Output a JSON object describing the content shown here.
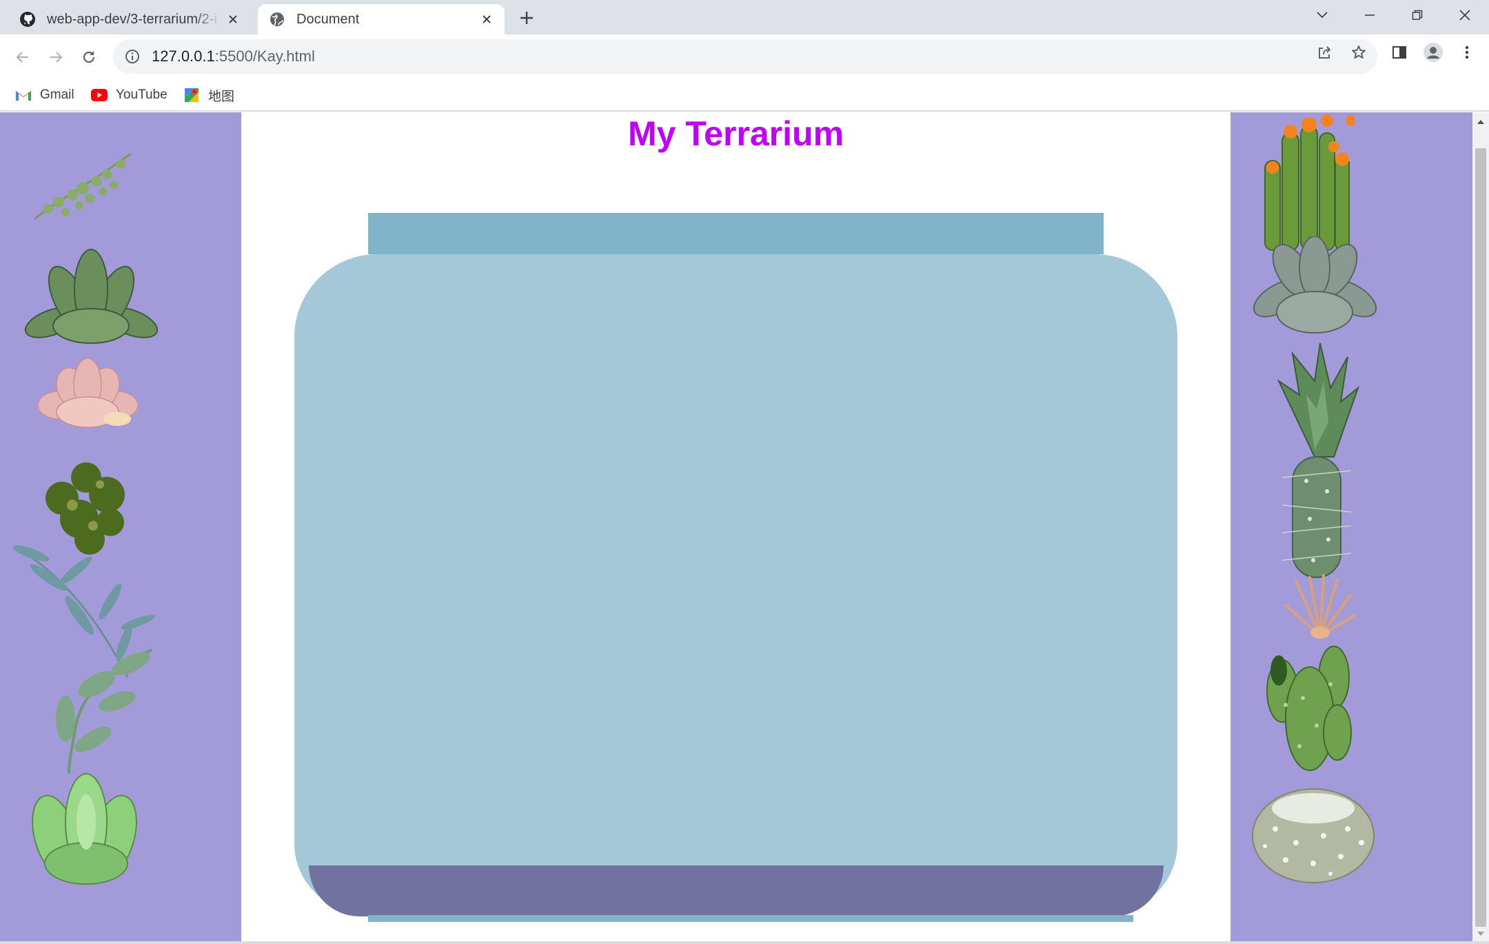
{
  "browser": {
    "tabs": [
      {
        "title": "web-app-dev/3-terrarium/2-i",
        "icon": "github-icon",
        "active": false
      },
      {
        "title": "Document",
        "icon": "globe-icon",
        "active": true
      }
    ],
    "address": {
      "host": "127.0.0.1",
      "path": ":5500/Kay.html"
    },
    "bookmarks": [
      {
        "label": "Gmail",
        "icon": "gmail-icon"
      },
      {
        "label": "YouTube",
        "icon": "youtube-icon"
      },
      {
        "label": "地图",
        "icon": "maps-icon"
      }
    ]
  },
  "page": {
    "title": "My Terrarium",
    "title_color": "#bf00ff",
    "panel_color": "#a39bd9",
    "jar_color": "#a4c8d7",
    "jar_rim_color": "#80b4c9",
    "dirt_color": "#72729e"
  },
  "plants": {
    "left": [
      "trailing-plant",
      "green-succulent",
      "pink-succulent",
      "dark-leafy-plant",
      "eucalyptus-branch",
      "ivy-vine",
      "jade-succulent"
    ],
    "right": [
      "flowering-cactus",
      "silver-succulent",
      "spiky-aloe",
      "column-cactus",
      "air-plant",
      "paddle-cactus",
      "round-white-cactus"
    ]
  }
}
